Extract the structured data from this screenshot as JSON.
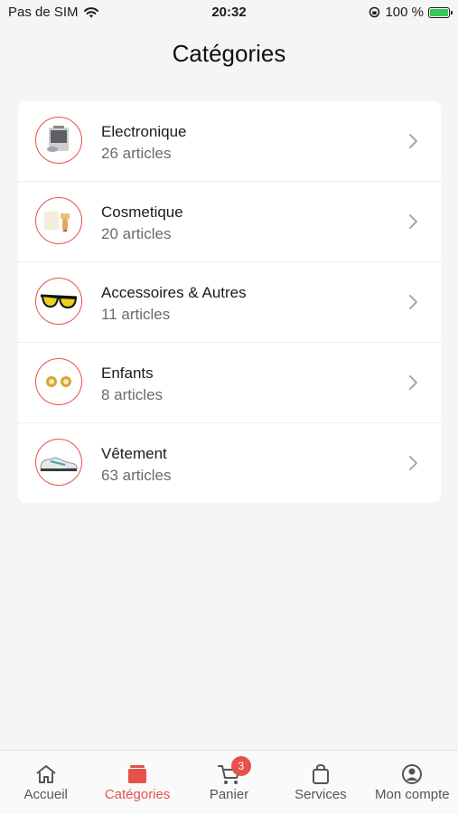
{
  "status_bar": {
    "carrier": "Pas de SIM",
    "time": "20:32",
    "battery_text": "100 %"
  },
  "page": {
    "title": "Catégories"
  },
  "categories": [
    {
      "name": "Electronique",
      "count": "26 articles",
      "icon": "electronics-thumbnail"
    },
    {
      "name": "Cosmetique",
      "count": "20 articles",
      "icon": "cosmetics-thumbnail"
    },
    {
      "name": "Accessoires & Autres",
      "count": "11 articles",
      "icon": "sunglasses-thumbnail"
    },
    {
      "name": "Enfants",
      "count": "8 articles",
      "icon": "earrings-thumbnail"
    },
    {
      "name": "Vêtement",
      "count": "63 articles",
      "icon": "sneaker-thumbnail"
    }
  ],
  "tabbar": {
    "items": [
      {
        "label": "Accueil",
        "icon": "home-icon"
      },
      {
        "label": "Catégories",
        "icon": "categories-icon",
        "active": true
      },
      {
        "label": "Panier",
        "icon": "cart-icon",
        "badge": "3"
      },
      {
        "label": "Services",
        "icon": "bag-icon"
      },
      {
        "label": "Mon compte",
        "icon": "account-icon"
      }
    ]
  },
  "colors": {
    "accent": "#e5524a",
    "background": "#f5f5f5",
    "card": "#ffffff"
  }
}
